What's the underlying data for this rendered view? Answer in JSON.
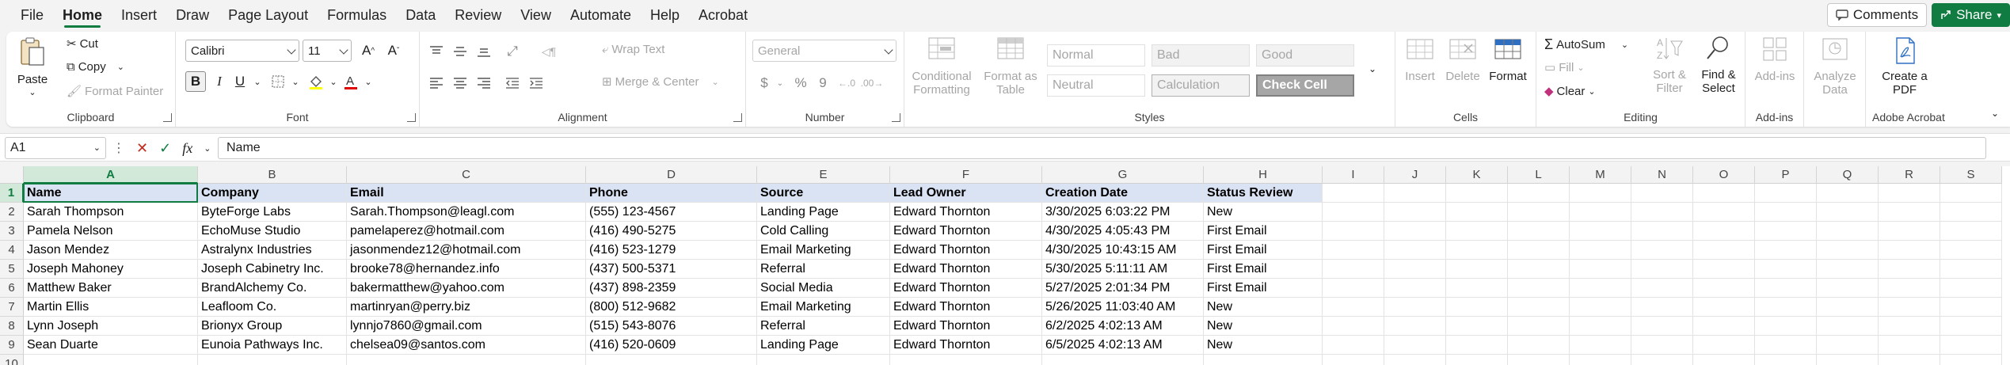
{
  "menu": {
    "tabs": [
      "File",
      "Home",
      "Insert",
      "Draw",
      "Page Layout",
      "Formulas",
      "Data",
      "Review",
      "View",
      "Automate",
      "Help",
      "Acrobat"
    ],
    "active": "Home",
    "comments_label": "Comments",
    "share_label": "Share"
  },
  "ribbon": {
    "clipboard": {
      "paste": "Paste",
      "cut": "Cut",
      "copy": "Copy",
      "format_painter": "Format Painter",
      "label": "Clipboard"
    },
    "font": {
      "family": "Calibri",
      "size": "11",
      "bold": "B",
      "italic": "I",
      "underline": "U",
      "label": "Font"
    },
    "alignment": {
      "wrap_text": "Wrap Text",
      "merge_center": "Merge & Center",
      "label": "Alignment"
    },
    "number": {
      "format": "General",
      "currency": "$",
      "percent": "%",
      "comma": "9",
      "label": "Number"
    },
    "styles": {
      "conditional_formatting": "Conditional Formatting",
      "format_as_table": "Format as Table",
      "normal": "Normal",
      "bad": "Bad",
      "good": "Good",
      "neutral": "Neutral",
      "calculation": "Calculation",
      "check_cell": "Check Cell",
      "label": "Styles"
    },
    "cells": {
      "insert": "Insert",
      "delete": "Delete",
      "format": "Format",
      "label": "Cells"
    },
    "editing": {
      "autosum": "AutoSum",
      "fill": "Fill",
      "clear": "Clear",
      "sort_filter": "Sort & Filter",
      "find_select": "Find & Select",
      "label": "Editing"
    },
    "addins": {
      "addins": "Add-ins",
      "label": "Add-ins"
    },
    "analyze": {
      "analyze_data": "Analyze Data"
    },
    "acrobat": {
      "create_pdf": "Create a PDF",
      "label": "Adobe Acrobat"
    }
  },
  "formula_bar": {
    "name_box": "A1",
    "fx": "fx",
    "content": "Name"
  },
  "sheet": {
    "columns": [
      "A",
      "B",
      "C",
      "D",
      "E",
      "F",
      "G",
      "H",
      "I",
      "J",
      "K",
      "L",
      "M",
      "N",
      "O",
      "P",
      "Q",
      "R",
      "S"
    ],
    "row_numbers": [
      "1",
      "2",
      "3",
      "4",
      "5",
      "6",
      "7",
      "8",
      "9",
      "10"
    ],
    "headers": [
      "Name",
      "Company",
      "Email",
      "Phone",
      "Source",
      "Lead Owner",
      "Creation Date",
      "Status Review"
    ],
    "rows": [
      [
        "Sarah Thompson",
        "ByteForge Labs",
        "Sarah.Thompson@leagl.com",
        "(555) 123-4567",
        "Landing Page",
        "Edward Thornton",
        "3/30/2025 6:03:22 PM",
        "New"
      ],
      [
        "Pamela Nelson",
        "EchoMuse Studio",
        "pamelaperez@hotmail.com",
        "(416) 490-5275",
        "Cold Calling",
        "Edward Thornton",
        "4/30/2025 4:05:43 PM",
        "First Email"
      ],
      [
        "Jason Mendez",
        "Astralynx Industries",
        "jasonmendez12@hotmail.com",
        "(416) 523-1279",
        "Email Marketing",
        "Edward Thornton",
        "4/30/2025 10:43:15 AM",
        "First Email"
      ],
      [
        "Joseph Mahoney",
        "Joseph Cabinetry Inc.",
        "brooke78@hernandez.info",
        "(437) 500-5371",
        "Referral",
        "Edward Thornton",
        "5/30/2025 5:11:11 AM",
        "First Email"
      ],
      [
        "Matthew Baker",
        "BrandAlchemy Co.",
        "bakermatthew@yahoo.com",
        "(437) 898-2359",
        "Social Media",
        "Edward Thornton",
        "5/27/2025 2:01:34 PM",
        "First Email"
      ],
      [
        "Martin Ellis",
        "Leafloom Co.",
        "martinryan@perry.biz",
        "(800) 512-9682",
        "Email Marketing",
        "Edward Thornton",
        "5/26/2025 11:03:40 AM",
        "New"
      ],
      [
        "Lynn Joseph",
        "Brionyx Group",
        "lynnjo7860@gmail.com",
        "(515) 543-8076",
        "Referral",
        "Edward Thornton",
        "6/2/2025 4:02:13 AM",
        "New"
      ],
      [
        "Sean Duarte",
        "Eunoia Pathways Inc.",
        "chelsea09@santos.com",
        "(416) 520-0609",
        "Landing Page",
        "Edward Thornton",
        "6/5/2025 4:02:13 AM",
        "New"
      ]
    ]
  },
  "colors": {
    "accent": "#107c41",
    "header_fill": "#dae3f3"
  }
}
